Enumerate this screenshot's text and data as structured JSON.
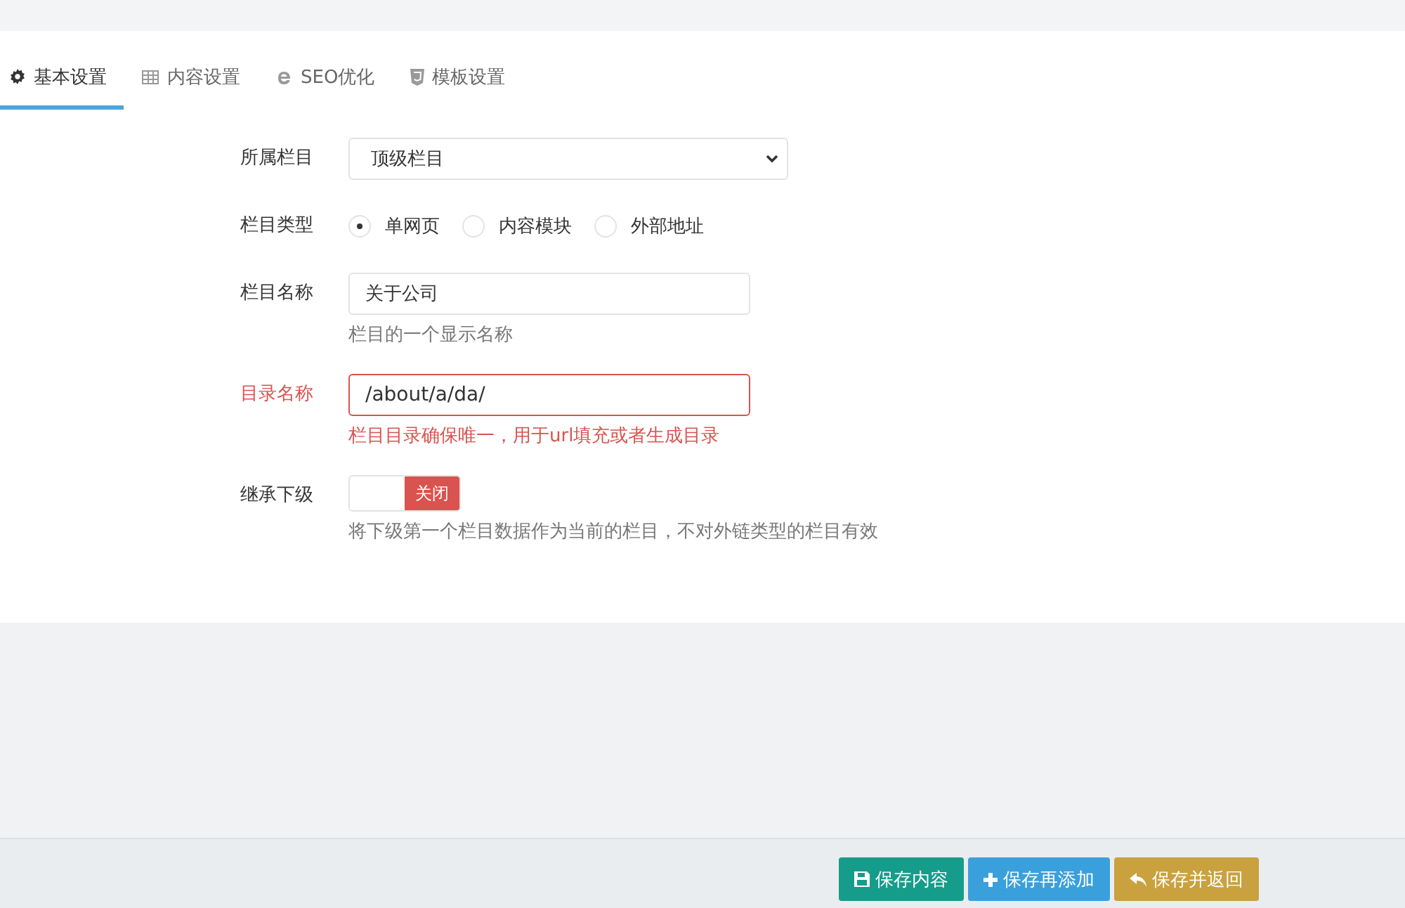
{
  "tabs": [
    {
      "label": "基本设置",
      "selected": true
    },
    {
      "label": "内容设置",
      "selected": false
    },
    {
      "label": "SEO优化",
      "selected": false
    },
    {
      "label": "模板设置",
      "selected": false
    }
  ],
  "fields": [
    {
      "kind": "select",
      "label": "所属栏目",
      "value": "顶级栏目",
      "error": false
    },
    {
      "kind": "radio",
      "label": "栏目类型",
      "error": false,
      "options": [
        {
          "label": "单网页",
          "selected": true
        },
        {
          "label": "内容模块",
          "selected": false
        },
        {
          "label": "外部地址",
          "selected": false
        }
      ]
    },
    {
      "kind": "text",
      "label": "栏目名称",
      "value": "关于公司",
      "help": "栏目的一个显示名称",
      "error": false
    },
    {
      "kind": "text",
      "label": "目录名称",
      "value": "/about/a/da/",
      "help": "栏目目录确保唯一，用于url填充或者生成目录",
      "error": true
    },
    {
      "kind": "switch",
      "label": "继承下级",
      "switch_label": "关闭",
      "on": false,
      "help": "将下级第一个栏目数据作为当前的栏目，不对外链类型的栏目有效",
      "error": false
    }
  ],
  "buttons": [
    {
      "label": "保存内容",
      "color": "#169c8a"
    },
    {
      "label": "保存再添加",
      "color": "#3aa0dc"
    },
    {
      "label": "保存并返回",
      "color": "#c9a13e"
    }
  ]
}
